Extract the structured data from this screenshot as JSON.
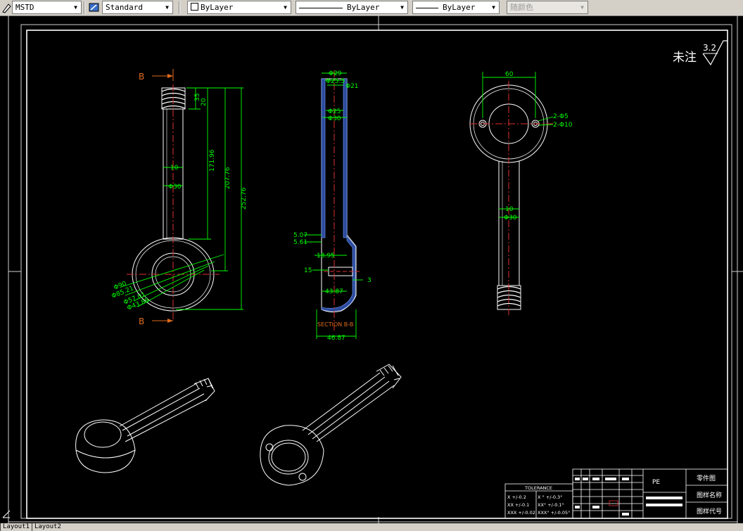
{
  "toolbar": {
    "text_style": "MSTD",
    "dim_style": "Standard",
    "layer": "ByLayer",
    "linetype": "ByLayer",
    "lineweight": "ByLayer",
    "plot_style": "随颜色"
  },
  "drawing": {
    "roughness_note": "未注",
    "roughness_value": "3.2",
    "section_mark_top": "B",
    "section_mark_bottom": "B",
    "section_label": "SECTION B-B",
    "front_dims": {
      "d35": "35",
      "d20": "20",
      "d171": "171.96",
      "d207": "207.76",
      "d252": "252.76",
      "phi10": "10",
      "phi30": "Φ30",
      "phi90": "Φ90",
      "phi85": "Φ85.21",
      "phi57": "Φ57.01",
      "phi43": "Φ43.88"
    },
    "section_dims": {
      "phi29": "Φ29",
      "phi25_5": "Φ25.5",
      "phi21": "Φ21",
      "phi25": "Φ25",
      "phi30": "Φ30",
      "d5_07": "5.07",
      "d5_61": "5.61",
      "d18_95": "18.95",
      "d15": "15",
      "d3": "3",
      "d43_87": "43.87",
      "d46_87": "46.87"
    },
    "side_dims": {
      "d60": "60",
      "hole5": "2-Φ5",
      "hole10": "2-Φ10",
      "d10": "10",
      "phi30": "Φ30"
    }
  },
  "title_block": {
    "part_type": "零件图",
    "drawing_name": "图样名称",
    "drawing_code": "图样代号",
    "material": "PE",
    "tolerance_header": "TOLERANCE",
    "tol_x": "X    +/-0.2",
    "tol_xx": "XX  +/-0.1",
    "tol_xxx": "XXX +/-0.02",
    "tol_a1": "X °   +/-0.3°",
    "tol_a2": "XX°  +/-0.1°",
    "tol_a3": "XXX° +/-0.05°"
  },
  "layout_tabs": [
    "Layout1",
    "Layout2"
  ]
}
